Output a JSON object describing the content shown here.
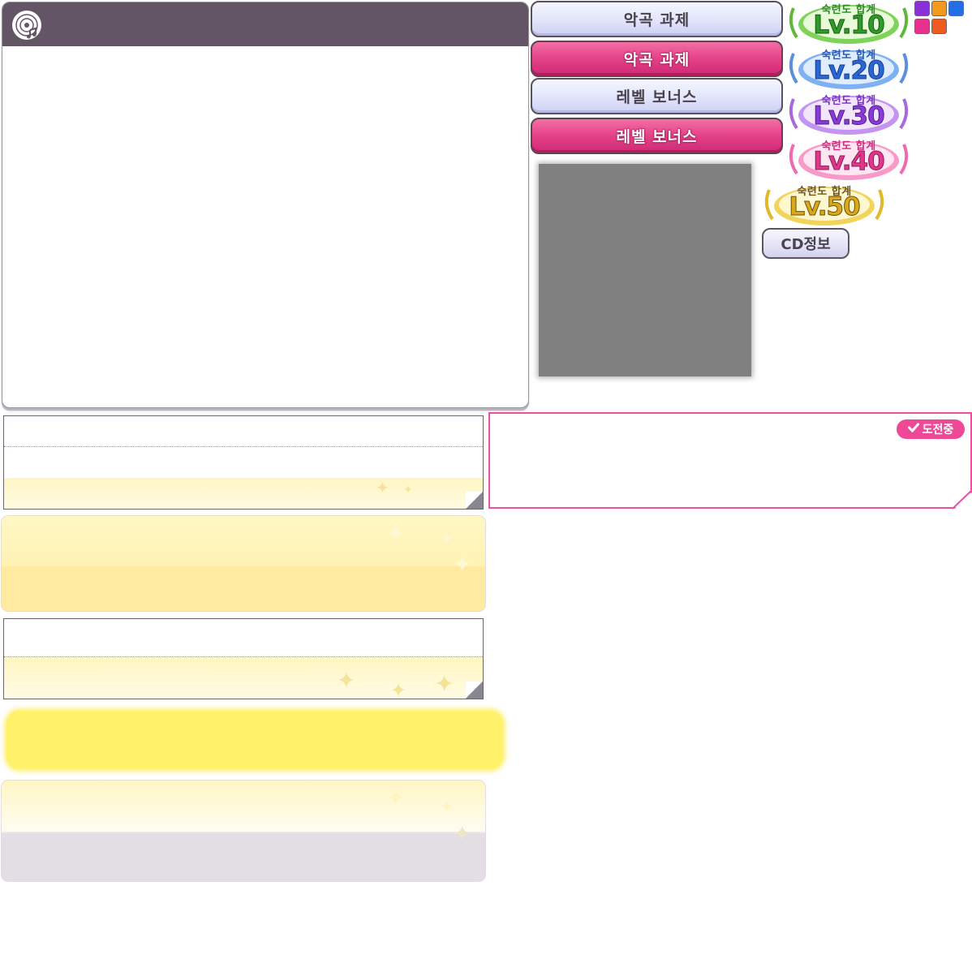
{
  "tabs": {
    "song_task_light": "악곡 과제",
    "song_task_active": "악곡 과제",
    "level_bonus_light": "레벨 보너스",
    "level_bonus_active": "레벨 보너스"
  },
  "badges": [
    {
      "label": "숙련도 합계",
      "level": "Lv.10",
      "theme": "green"
    },
    {
      "label": "숙련도 합계",
      "level": "Lv.20",
      "theme": "blue"
    },
    {
      "label": "숙련도 합계",
      "level": "Lv.30",
      "theme": "purple"
    },
    {
      "label": "숙련도 합계",
      "level": "Lv.40",
      "theme": "pink"
    },
    {
      "label": "숙련도 합계",
      "level": "Lv.50",
      "theme": "gold"
    }
  ],
  "colors": {
    "square_purple": "#8b2fd6",
    "square_orange": "#f39a1c",
    "square_blue": "#2370e6",
    "square_magenta": "#e8308d",
    "square_red": "#ef5a20",
    "header": "#635565",
    "accent_pink": "#ee4896"
  },
  "cd_info_label": "CD정보",
  "challenge": {
    "status_label": "도전중",
    "check_icon": "check-icon"
  }
}
